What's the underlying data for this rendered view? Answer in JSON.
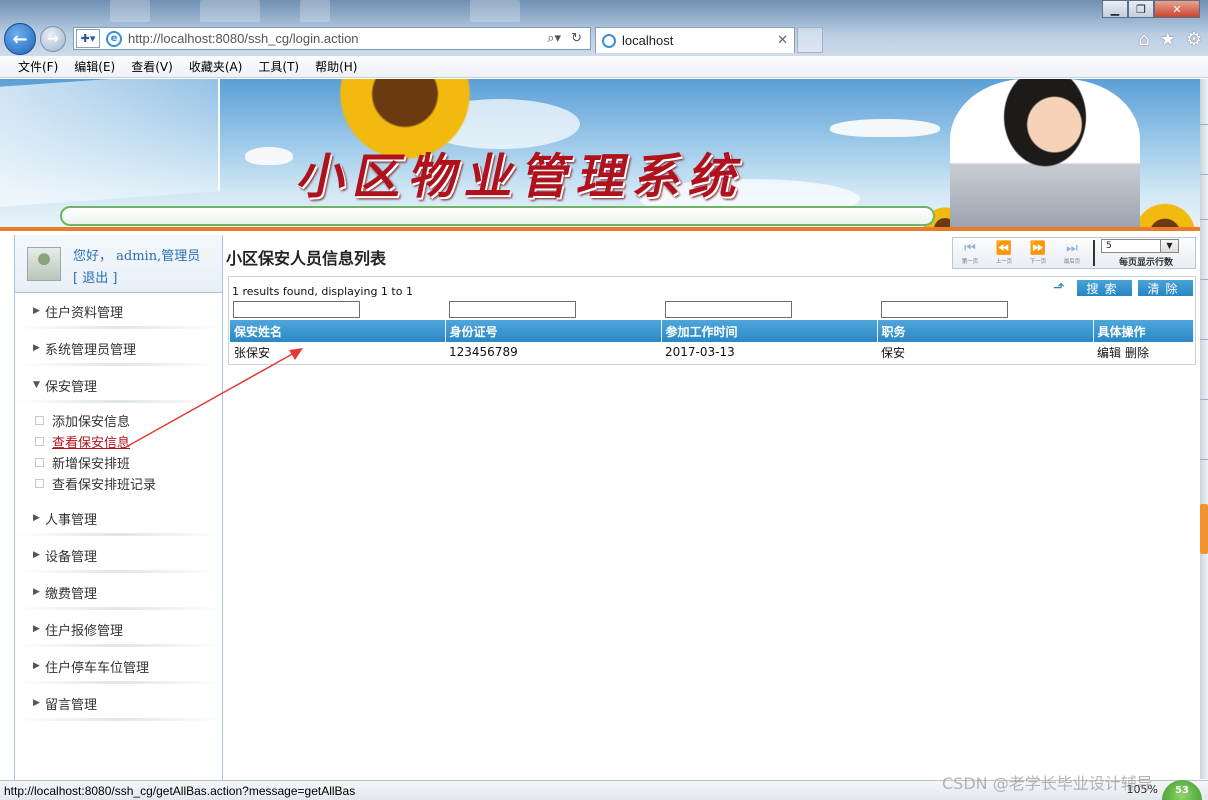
{
  "browser": {
    "address_url": "http://localhost:8080/ssh_cg/login.action",
    "address_host": "localhost",
    "tab_title": "localhost",
    "menu": [
      "文件(F)",
      "编辑(E)",
      "查看(V)",
      "收藏夹(A)",
      "工具(T)",
      "帮助(H)"
    ]
  },
  "banner": {
    "title": "小区物业管理系统"
  },
  "sidebar": {
    "greeting": "您好， admin,管理员",
    "logout": "[ 退出 ]",
    "items": [
      {
        "label": "住户资料管理"
      },
      {
        "label": "系统管理员管理"
      },
      {
        "label": "保安管理"
      }
    ],
    "subitems": [
      {
        "label": "添加保安信息"
      },
      {
        "label": "查看保安信息"
      },
      {
        "label": "新增保安排班"
      },
      {
        "label": "查看保安排班记录"
      }
    ],
    "items_after": [
      {
        "label": "人事管理"
      },
      {
        "label": "设备管理"
      },
      {
        "label": "缴费管理"
      },
      {
        "label": "住户报修管理"
      },
      {
        "label": "住户停车车位管理"
      },
      {
        "label": "留言管理"
      }
    ]
  },
  "content": {
    "title": "小区保安人员信息列表",
    "pager": {
      "first": "第一页",
      "prev": "上一页",
      "next": "下一页",
      "last": "最后页",
      "page_size": "5",
      "page_size_label": "每页显示行数"
    },
    "results_text": "1 results found, displaying 1 to 1",
    "search_label": "搜索",
    "clear_label": "清除",
    "columns": [
      "保安姓名",
      "身份证号",
      "参加工作时间",
      "职务",
      "具体操作"
    ],
    "rows": [
      {
        "name": "张保安",
        "id_number": "123456789",
        "start_date": "2017-03-13",
        "position": "保安",
        "edit": "编辑",
        "delete": "删除"
      }
    ]
  },
  "statusbar": {
    "url": "http://localhost:8080/ssh_cg/getAllBas.action?message=getAllBas",
    "zoom": "105%",
    "badge": "53"
  },
  "watermark": "CSDN @老学长毕业设计辅导",
  "colors": {
    "accent": "#2b88c6",
    "title_red": "#b0121d",
    "link_blue": "#2d6fb5",
    "annotation_red": "#e53935"
  }
}
